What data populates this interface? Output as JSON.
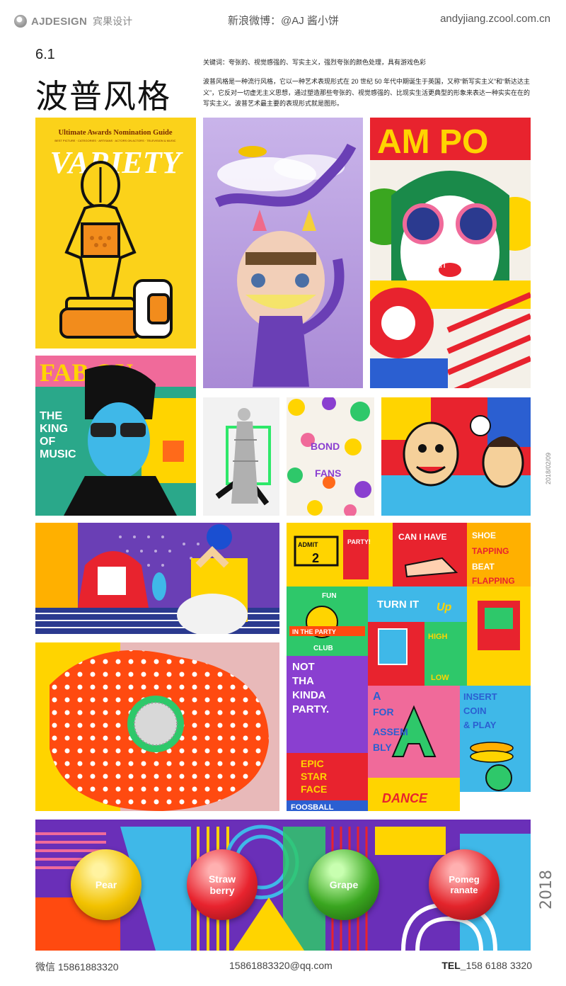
{
  "header": {
    "brand": "AJDESIGN",
    "brand_cn": "宾果设计",
    "weibo": "新浪微博：@AJ 酱小饼",
    "site": "andyjiang.zcool.com.cn"
  },
  "intro": {
    "section_number": "6.1",
    "title": "波普风格",
    "keywords": "关键词：夸张的、视觉感强的、写实主义，强烈夸张的颜色处理，具有游戏色彩",
    "description": "波普风格是一种流行风格，它以一种艺术表现形式在 20 世纪 50 年代中期诞生于英国，又称“新写实主义”和“新达达主义”，它反对一切虚无主义思想，通过塑造那些夸张的、视觉感强的、比现实生活更典型的形象来表达一种实实在在的写实主义。波普艺术最主要的表现形式就是图形。"
  },
  "tiles": {
    "variety": {
      "guide": "Ultimate Awards Nomination Guide",
      "logo": "VARIETY",
      "tagline": "BEST PICTURE · CATEGORIES · ARTISANS · ACTORS ON ACTORS · TELEVISION & MUSIC"
    },
    "woman": {
      "headline": "AM PO",
      "badge": "th"
    },
    "music": {
      "masthead": "FAB  OU",
      "lines": [
        "THE",
        "KING",
        "OF",
        "MUSIC"
      ]
    },
    "bond": {
      "lines": [
        "BOND",
        "FANS"
      ]
    },
    "posters": {
      "admit": "ADMIT",
      "admit_num": "2",
      "party": "PARTY!",
      "can_i_have": "CAN I HAVE",
      "shoe_lines": [
        "SHOE",
        "TAPPING",
        "BEAT",
        "FLAPPING"
      ],
      "fun": "FUN",
      "in_the_party": "IN THE PARTY",
      "club": "CLUB",
      "turn_it": "TURN IT",
      "up": "Up",
      "high": "HIGH",
      "low": "LOW",
      "not_lines": [
        "NOT",
        "THA",
        "KINDA",
        "PARTY."
      ],
      "assembly_lines": [
        "A",
        "FOR",
        "ASSEM",
        "BLY"
      ],
      "coin_lines": [
        "INSERT",
        "COIN",
        "& PLAY"
      ],
      "epic_lines": [
        "EPIC",
        "STAR",
        "FACE"
      ],
      "dance": "DANCE",
      "foosball": "FOOSBALL"
    },
    "fruits": [
      {
        "name": "Pear",
        "color": "#f2c200"
      },
      {
        "name": "Straw berry",
        "color": "#e8232e"
      },
      {
        "name": "Grape",
        "color": "#3aa620"
      },
      {
        "name": "Pomeg ranate",
        "color": "#e3242b"
      }
    ]
  },
  "side": {
    "date": "2018/02/09",
    "year": "2018"
  },
  "footer": {
    "wechat": "微信 15861883320",
    "email": "15861883320@qq.com",
    "tel_label": "TEL_",
    "tel_number": "158 6188 3320"
  }
}
